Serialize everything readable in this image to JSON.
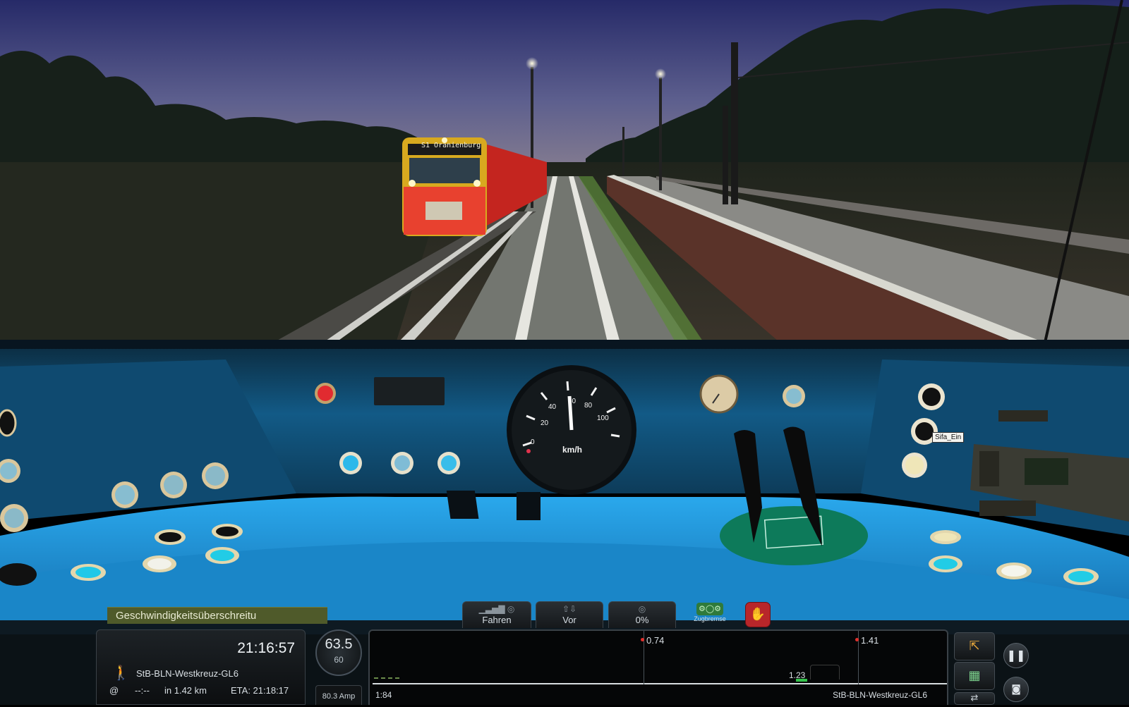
{
  "scene": {
    "train_destination_board": "S1 Oranienburg",
    "tooltip": "Sifa_Ein"
  },
  "cab": {
    "speedometer_unit": "km/h",
    "speedometer_ticks": [
      "0",
      "20",
      "40",
      "60",
      "80",
      "100"
    ]
  },
  "hud": {
    "message": "Geschwindigkeitsüberschreitu",
    "controls": [
      {
        "label": "Fahren",
        "icon": "power-bars-icon"
      },
      {
        "label": "Vor",
        "icon": "direction-arrows-icon"
      },
      {
        "label": "0%",
        "icon": "brake-dial-icon"
      }
    ],
    "train_brake_label": "Zugbremse",
    "emergency_icon": "emergency-hand-icon",
    "info": {
      "clock": "21:16:57",
      "route": "StB-BLN-Westkreuz-GL6",
      "at_symbol": "@",
      "distance_placeholder": "--:--",
      "in_distance": "in 1.42 km",
      "eta": "ETA:  21:18:17"
    },
    "speed": {
      "current": "63.5",
      "limit": "60"
    },
    "amperage": "80.3 Amp",
    "track_monitor": {
      "left_time": "1:84",
      "markers": [
        "0.74",
        "1.41"
      ],
      "distance_label": "1.23",
      "route_label": "StB-BLN-Westkreuz-GL6"
    },
    "side_buttons": [
      "pause-icon",
      "camera-icon"
    ]
  },
  "colors": {
    "dashboard": "#1f8fd0",
    "sky_top": "#2b2f6f",
    "warning_bar": "#4f5a2a"
  }
}
